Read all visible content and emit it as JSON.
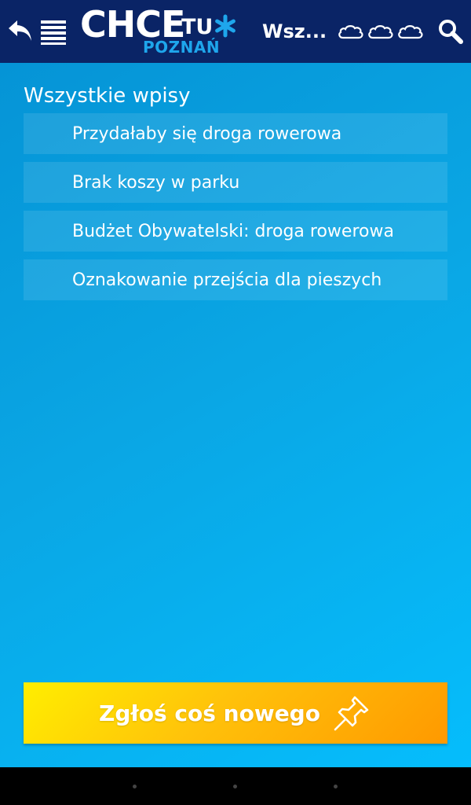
{
  "topbar": {
    "logo_main": "CHCE",
    "logo_tu": "TU",
    "logo_city": "POZNAŃ",
    "title": "Wsz...",
    "icons": [
      "back-arrow-icon",
      "menu-icon",
      "cloud-icon",
      "cloud-icon",
      "cloud-icon",
      "search-icon"
    ]
  },
  "content": {
    "heading": "Wszystkie wpisy",
    "items": [
      {
        "label": "Przydałaby się droga rowerowa"
      },
      {
        "label": "Brak koszy w parku"
      },
      {
        "label": "Budżet Obywatelski: droga rowerowa"
      },
      {
        "label": "Oznakowanie przejścia dla pieszych"
      }
    ],
    "report_button": "Zgłoś coś nowego"
  },
  "colors": {
    "topbar_bg": "#0a2466",
    "content_bg": "#0aa6e4",
    "accent": "#1ea6ec",
    "button_start": "#ffee00",
    "button_end": "#ff9900"
  }
}
